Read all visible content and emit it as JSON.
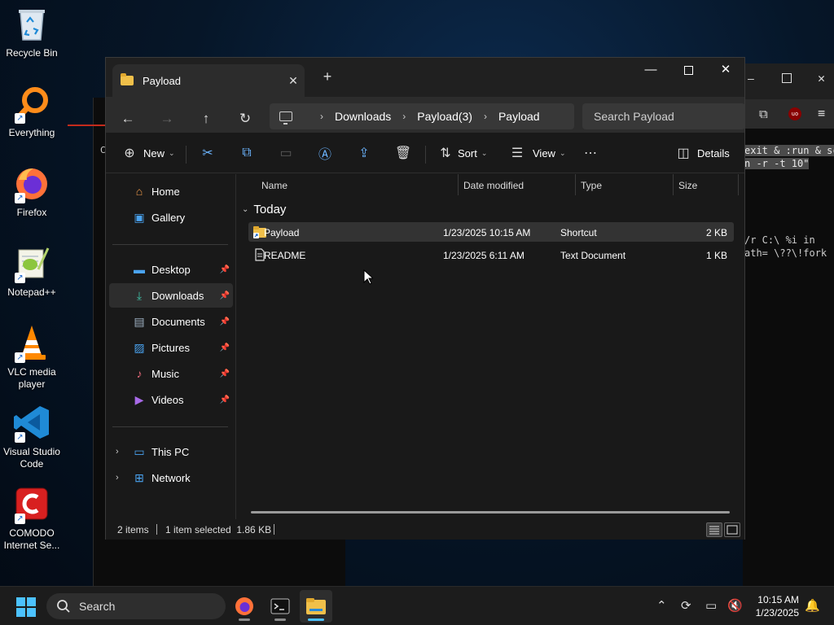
{
  "desktop": {
    "icons": [
      {
        "label": "Recycle Bin",
        "icon": "recycle-bin-icon"
      },
      {
        "label": "Everything",
        "icon": "magnifier-icon"
      },
      {
        "label": "Firefox",
        "icon": "firefox-icon"
      },
      {
        "label": "Notepad++",
        "icon": "notepad-plus-plus-icon"
      },
      {
        "label": "VLC media player",
        "icon": "vlc-cone-icon"
      },
      {
        "label": "Visual Studio Code",
        "icon": "vscode-icon"
      },
      {
        "label": "COMODO Internet Se...",
        "icon": "comodo-icon"
      }
    ]
  },
  "background_terminal": {
    "line1": "exit & :run & sc",
    "line2": "n -r -t 10\"",
    "line3": "/r C:\\ %i in",
    "line4": "ath= \\??\\!fork",
    "left_fragment": "C"
  },
  "explorer": {
    "tab_title": "Payload",
    "address": {
      "segments": [
        "Downloads",
        "Payload(3)",
        "Payload"
      ]
    },
    "search_placeholder": "Search Payload",
    "commands": {
      "new": "New",
      "sort": "Sort",
      "view": "View",
      "details": "Details"
    },
    "sidebar": {
      "items": [
        {
          "label": "Home",
          "icon": "home-icon",
          "pinned": false
        },
        {
          "label": "Gallery",
          "icon": "gallery-icon",
          "pinned": false
        },
        {
          "label": "Desktop",
          "icon": "desktop-icon",
          "pinned": true
        },
        {
          "label": "Downloads",
          "icon": "download-icon",
          "pinned": true,
          "selected": true
        },
        {
          "label": "Documents",
          "icon": "documents-icon",
          "pinned": true
        },
        {
          "label": "Pictures",
          "icon": "pictures-icon",
          "pinned": true
        },
        {
          "label": "Music",
          "icon": "music-icon",
          "pinned": true
        },
        {
          "label": "Videos",
          "icon": "videos-icon",
          "pinned": true
        },
        {
          "label": "This PC",
          "icon": "this-pc-icon",
          "expandable": true
        },
        {
          "label": "Network",
          "icon": "network-icon",
          "expandable": true
        }
      ]
    },
    "columns": [
      "Name",
      "Date modified",
      "Type",
      "Size"
    ],
    "group_label": "Today",
    "files": [
      {
        "name": "Payload",
        "date": "1/23/2025 10:15 AM",
        "type": "Shortcut",
        "size": "2 KB",
        "selected": true
      },
      {
        "name": "README",
        "date": "1/23/2025 6:11 AM",
        "type": "Text Document",
        "size": "1 KB",
        "selected": false
      }
    ],
    "status": {
      "count": "2 items",
      "selection": "1 item selected  1.86 KB"
    }
  },
  "taskbar": {
    "search_label": "Search",
    "time": "10:15 AM",
    "date": "1/23/2025"
  },
  "colors": {
    "accent": "#4cc2ff",
    "folder": "#f0c04a",
    "window_bg": "#191919"
  }
}
